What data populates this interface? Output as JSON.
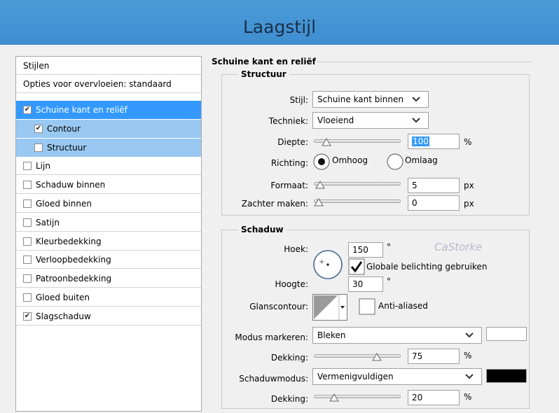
{
  "window": {
    "title": "Laagstijl"
  },
  "styles_panel": {
    "header": "Stijlen",
    "blend_options": "Opties voor overvloeien: standaard",
    "items": [
      {
        "label": "Schuine kant en reliëf",
        "checked": true
      },
      {
        "label": "Contour",
        "checked": true
      },
      {
        "label": "Structuur",
        "checked": false
      },
      {
        "label": "Lijn",
        "checked": false
      },
      {
        "label": "Schaduw binnen",
        "checked": false
      },
      {
        "label": "Gloed binnen",
        "checked": false
      },
      {
        "label": "Satijn",
        "checked": false
      },
      {
        "label": "Kleurbedekking",
        "checked": false
      },
      {
        "label": "Verloopbedekking",
        "checked": false
      },
      {
        "label": "Patroonbedekking",
        "checked": false
      },
      {
        "label": "Gloed buiten",
        "checked": false
      },
      {
        "label": "Slagschaduw",
        "checked": true
      }
    ]
  },
  "bevel": {
    "section_title": "Schuine kant en reliëf",
    "structure": {
      "title": "Structuur",
      "style_label": "Stijl:",
      "style_value": "Schuine kant binnen",
      "technique_label": "Techniek:",
      "technique_value": "Vloeiend",
      "depth_label": "Diepte:",
      "depth_value": "100",
      "depth_unit": "%",
      "direction_label": "Richting:",
      "direction_up": "Omhoog",
      "direction_down": "Omlaag",
      "direction_selected": "up",
      "size_label": "Formaat:",
      "size_value": "5",
      "size_unit": "px",
      "soften_label": "Zachter maken:",
      "soften_value": "0",
      "soften_unit": "px"
    },
    "shading": {
      "title": "Schaduw",
      "watermark": "CaStorke",
      "angle_label": "Hoek:",
      "angle_value": "150",
      "angle_unit": "°",
      "global_light_label": "Globale belichting gebruiken",
      "global_light_checked": true,
      "altitude_label": "Hoogte:",
      "altitude_value": "30",
      "altitude_unit": "°",
      "gloss_label": "Glanscontour:",
      "anti_alias_label": "Anti-aliased",
      "anti_alias_checked": false,
      "highlight_mode_label": "Modus markeren:",
      "highlight_mode_value": "Bleken",
      "highlight_color": "#ffffff",
      "highlight_opacity_label": "Dekking:",
      "highlight_opacity_value": "75",
      "highlight_opacity_unit": "%",
      "shadow_mode_label": "Schaduwmodus:",
      "shadow_mode_value": "Vermenigvuldigen",
      "shadow_color": "#000000",
      "shadow_opacity_label": "Dekking:",
      "shadow_opacity_value": "20",
      "shadow_opacity_unit": "%"
    }
  },
  "sliders": {
    "depth": 0.1,
    "size": 0.02,
    "soften": 0.0,
    "highlight_opacity": 0.75,
    "shadow_opacity": 0.2
  },
  "colors": {
    "titlebar": "#4296d4",
    "selected": "#3399ff",
    "sub_selected": "#99c9f2"
  }
}
